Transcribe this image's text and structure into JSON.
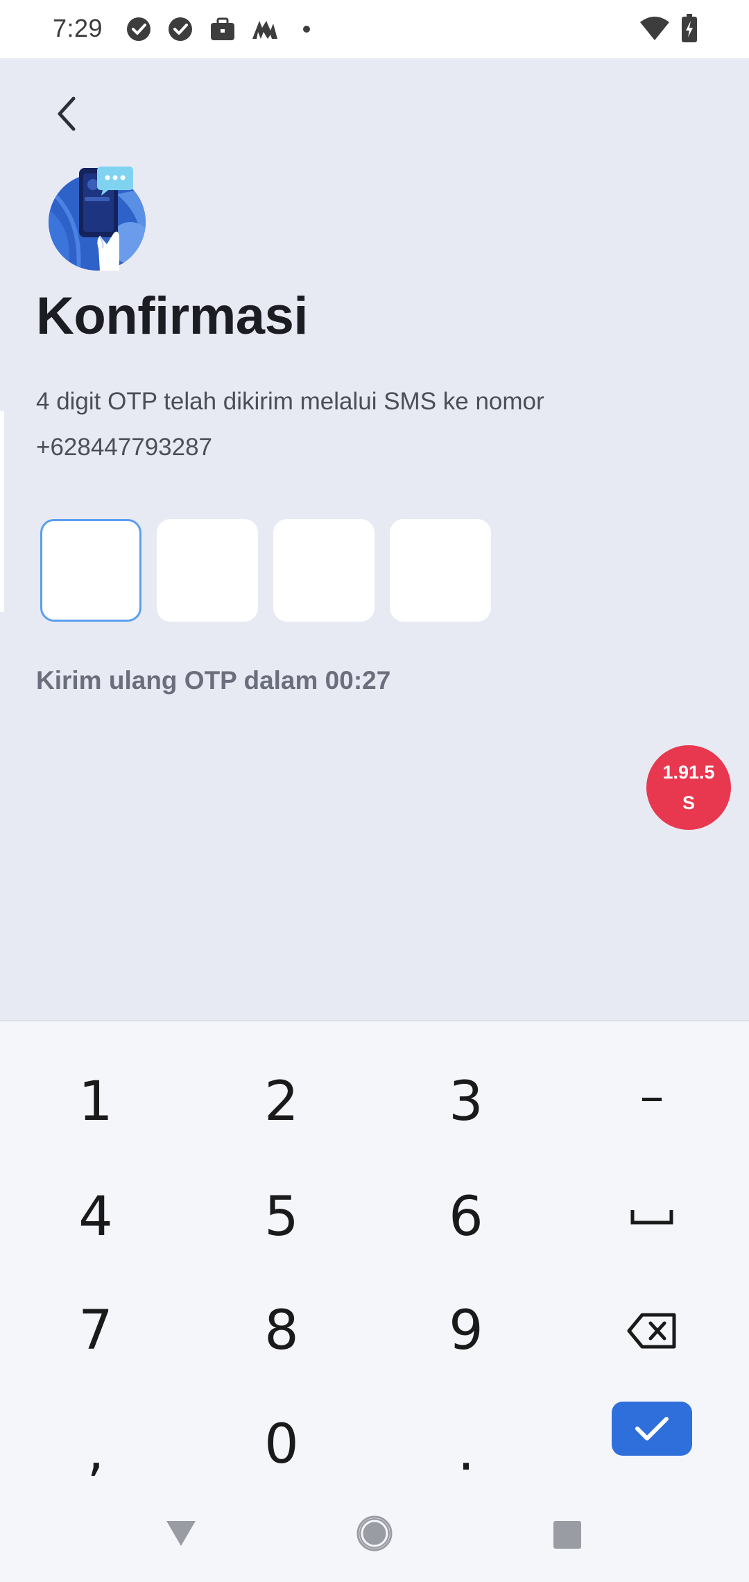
{
  "status_bar": {
    "time": "7:29",
    "icons": [
      "check-circle-icon",
      "check-circle-icon",
      "briefcase-icon",
      "app-logo-icon",
      "dot-icon",
      "wifi-icon",
      "battery-charging-icon"
    ]
  },
  "header": {
    "back_icon": "chevron-left-icon"
  },
  "main": {
    "title": "Konfirmasi",
    "subtitle_line1": "4 digit OTP telah dikirim melalui SMS ke nomor",
    "subtitle_line2": "+628447793287",
    "otp_digits": [
      "",
      "",
      "",
      ""
    ],
    "resend_text": "Kirim ulang OTP dalam 00:27"
  },
  "badge": {
    "line1": "1.91.5",
    "line2": "S"
  },
  "keyboard": {
    "rows": [
      [
        "1",
        "2",
        "3",
        "–"
      ],
      [
        "4",
        "5",
        "6",
        "space"
      ],
      [
        "7",
        "8",
        "9",
        "backspace"
      ],
      [
        ",",
        "0",
        ".",
        "enter"
      ]
    ]
  },
  "colors": {
    "background": "#e8eaf3",
    "accent": "#2f6fdc",
    "badge": "#e8384f",
    "active_border": "#5b9ef0"
  }
}
